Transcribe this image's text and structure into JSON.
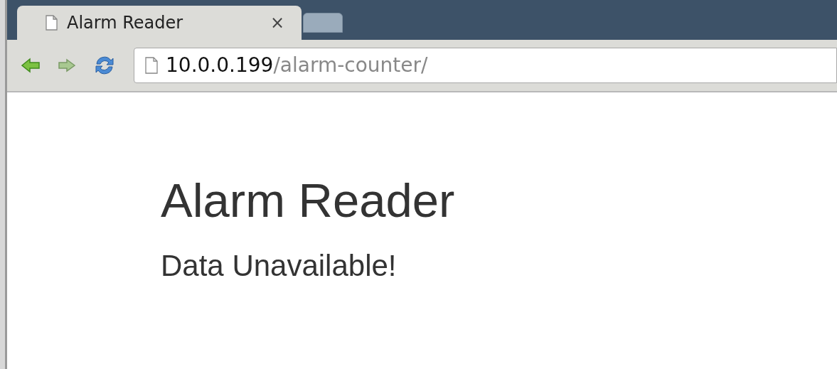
{
  "tabs": [
    {
      "title": "Alarm Reader",
      "close": "×",
      "selected": true
    },
    {
      "selected": false
    }
  ],
  "address_bar": {
    "host": "10.0.0.199",
    "path": "/alarm-counter/"
  },
  "page": {
    "heading": "Alarm Reader",
    "message": "Data Unavailable!"
  }
}
